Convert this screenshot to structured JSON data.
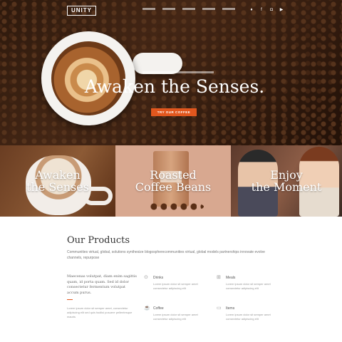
{
  "nav": {
    "logo": "UNITY",
    "socials": [
      "twitter-icon",
      "facebook-icon",
      "instagram-icon",
      "youtube-icon"
    ]
  },
  "hero": {
    "title": "Awaken the Senses.",
    "cta": "TRY OUR COFFEE"
  },
  "panels": [
    {
      "title_line1": "Awaken",
      "title_line2": "the Senses"
    },
    {
      "title_line1": "Roasted",
      "title_line2": "Coffee Beans"
    },
    {
      "title_line1": "Enjoy",
      "title_line2": "the Moment"
    }
  ],
  "products": {
    "title": "Our Products",
    "description": "Communities virtual, global, solutions synthesize blogospherecommunities virtual, global models partnerships innovate evolve channels, repurpose",
    "intro": "Maecenas volutpat, diam enim sagittis quam, id porta quam. Sed id dolor consectetur fermentum volutpat accum purus.",
    "intro_small": "Lorem ipsum dolor sit semper amet, consectetur adipiscing elit sed quis facilisi posuere pellentesque mauris",
    "features": [
      {
        "icon": "pin-icon",
        "title": "Drinks",
        "text": "Lorem ipsum dolor sit semper amet consectetur adipiscing elit"
      },
      {
        "icon": "cart-icon",
        "title": "Meals",
        "text": "Lorem ipsum dolor sit semper amet consectetur adipiscing elit"
      },
      {
        "icon": "cup-icon",
        "title": "Coffee",
        "text": "Lorem ipsum dolor sit semper amet consectetur adipiscing elit"
      },
      {
        "icon": "book-icon",
        "title": "Items",
        "text": "Lorem ipsum dolor sit semper amet consectetur adipiscing elit"
      }
    ]
  }
}
